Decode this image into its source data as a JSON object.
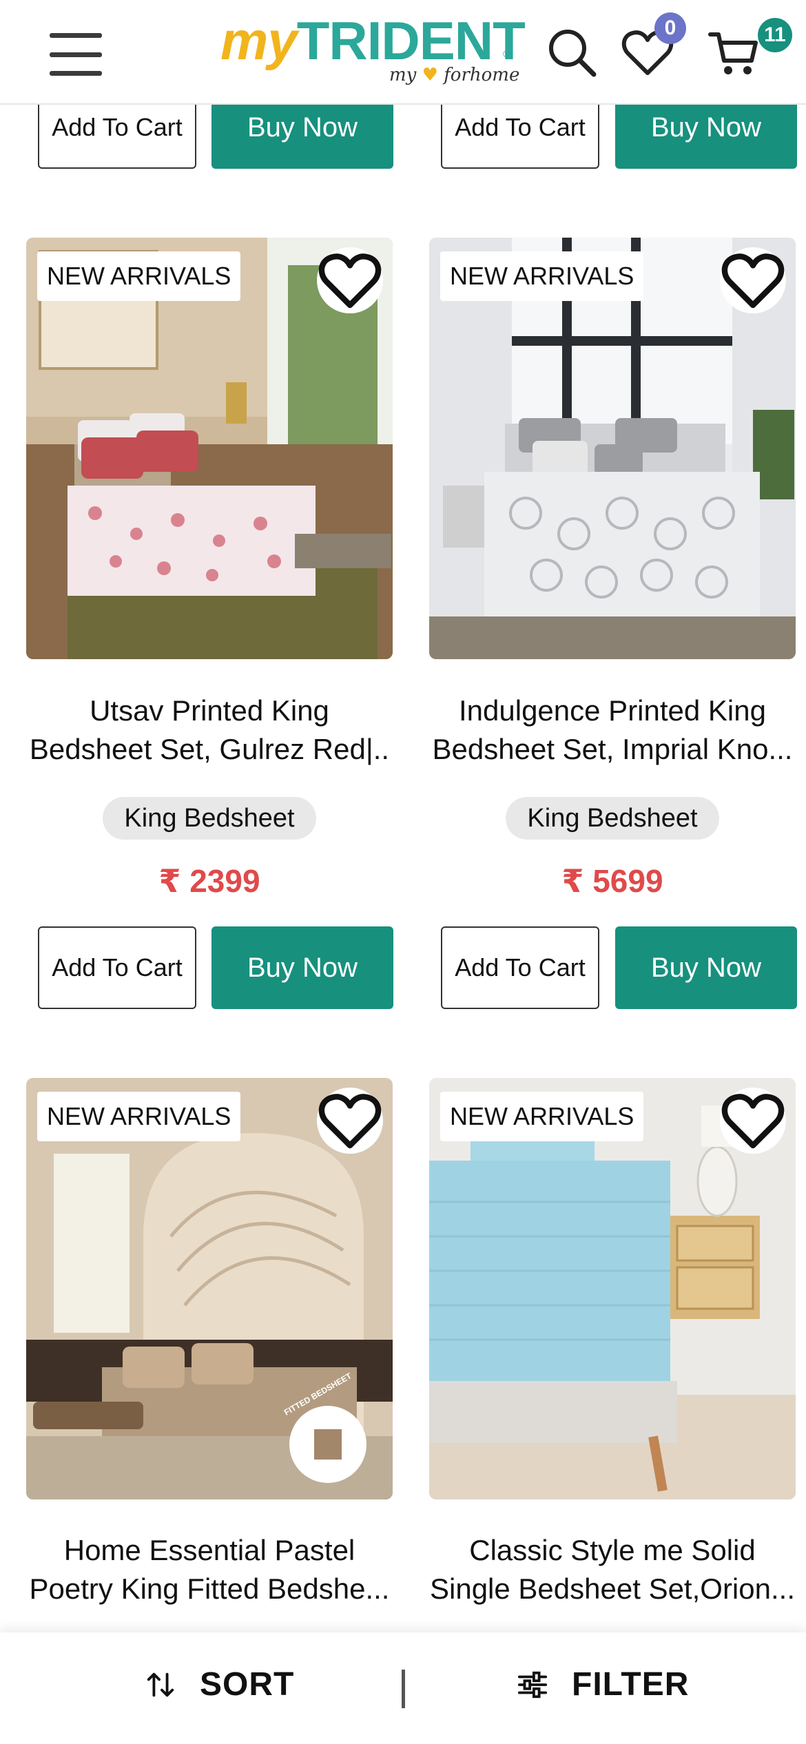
{
  "header": {
    "logo_my": "my",
    "logo_brand": "TRIDENT",
    "logo_reg": "®",
    "logo_tag_1": "my",
    "logo_tag_2": "forhome",
    "wishlist_count": "0",
    "cart_count": "11"
  },
  "top_row": {
    "add_to_cart": "Add To Cart",
    "buy_now": "Buy Now"
  },
  "products": [
    {
      "badge": "NEW ARRIVALS",
      "title_line1": "Utsav Printed King",
      "title_line2": "Bedsheet Set, Gulrez Red|..",
      "category": "King Bedsheet",
      "price": "₹ 2399",
      "add_to_cart": "Add To Cart",
      "buy_now": "Buy Now"
    },
    {
      "badge": "NEW ARRIVALS",
      "title_line1": "Indulgence Printed King",
      "title_line2": "Bedsheet Set, Imprial Kno...",
      "category": "King Bedsheet",
      "price": "₹ 5699",
      "add_to_cart": "Add To Cart",
      "buy_now": "Buy Now"
    },
    {
      "badge": "NEW ARRIVALS",
      "title_line1": "Home Essential Pastel",
      "title_line2": "Poetry King Fitted Bedshe...",
      "fitted_label": "FITTED BEDSHEET"
    },
    {
      "badge": "NEW ARRIVALS",
      "title_line1": "Classic Style me Solid",
      "title_line2": "Single Bedsheet Set,Orion..."
    }
  ],
  "bottom_bar": {
    "sort_label": "SORT",
    "filter_label": "FILTER"
  },
  "colors": {
    "brand_teal": "#17907e",
    "logo_yellow": "#f2b41d",
    "price_red": "#e04a4a",
    "wishlist_badge": "#6b74c9"
  }
}
